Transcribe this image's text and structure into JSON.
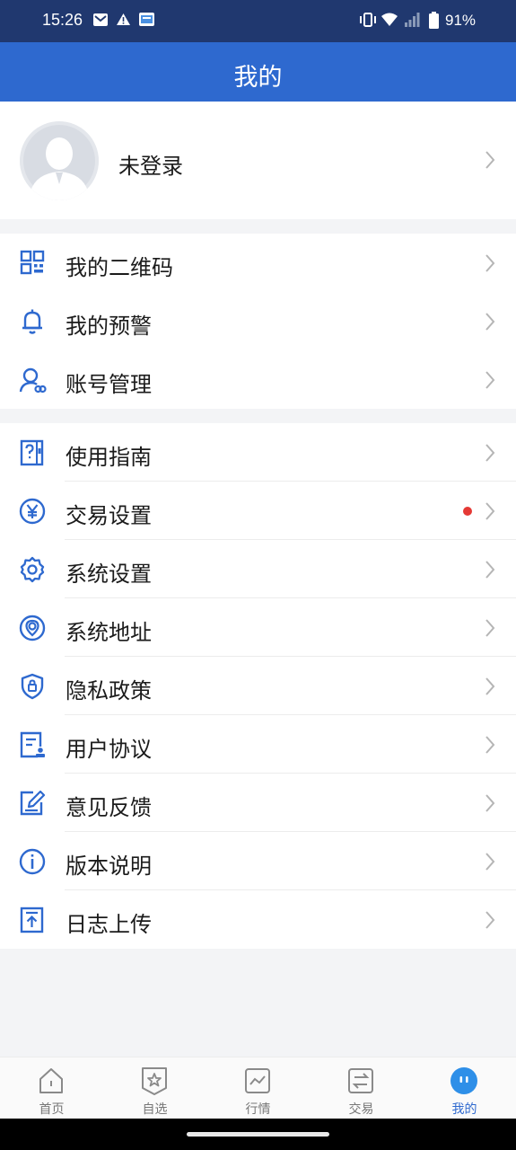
{
  "status_bar": {
    "time": "15:26",
    "battery": "91%"
  },
  "header": {
    "title": "我的"
  },
  "profile": {
    "name": "未登录"
  },
  "group1": [
    {
      "label": "我的二维码",
      "icon": "qr-code-icon"
    },
    {
      "label": "我的预警",
      "icon": "bell-icon"
    },
    {
      "label": "账号管理",
      "icon": "account-icon"
    }
  ],
  "group2": [
    {
      "label": "使用指南",
      "icon": "guide-icon"
    },
    {
      "label": "交易设置",
      "icon": "yen-icon",
      "badge": "red-dot"
    },
    {
      "label": "系统设置",
      "icon": "gear-icon"
    },
    {
      "label": "系统地址",
      "icon": "location-icon"
    },
    {
      "label": "隐私政策",
      "icon": "shield-icon"
    },
    {
      "label": "用户协议",
      "icon": "agreement-icon"
    },
    {
      "label": "意见反馈",
      "icon": "feedback-icon"
    },
    {
      "label": "版本说明",
      "icon": "info-icon"
    },
    {
      "label": "日志上传",
      "icon": "upload-icon"
    }
  ],
  "tabbar": {
    "tabs": [
      {
        "label": "首页",
        "icon": "home-icon"
      },
      {
        "label": "自选",
        "icon": "star-icon"
      },
      {
        "label": "行情",
        "icon": "chart-icon"
      },
      {
        "label": "交易",
        "icon": "exchange-icon"
      },
      {
        "label": "我的",
        "icon": "face-icon",
        "active": true
      }
    ]
  },
  "colors": {
    "primary": "#2e69cf",
    "status_bar": "#20386f",
    "badge": "#e53935"
  }
}
